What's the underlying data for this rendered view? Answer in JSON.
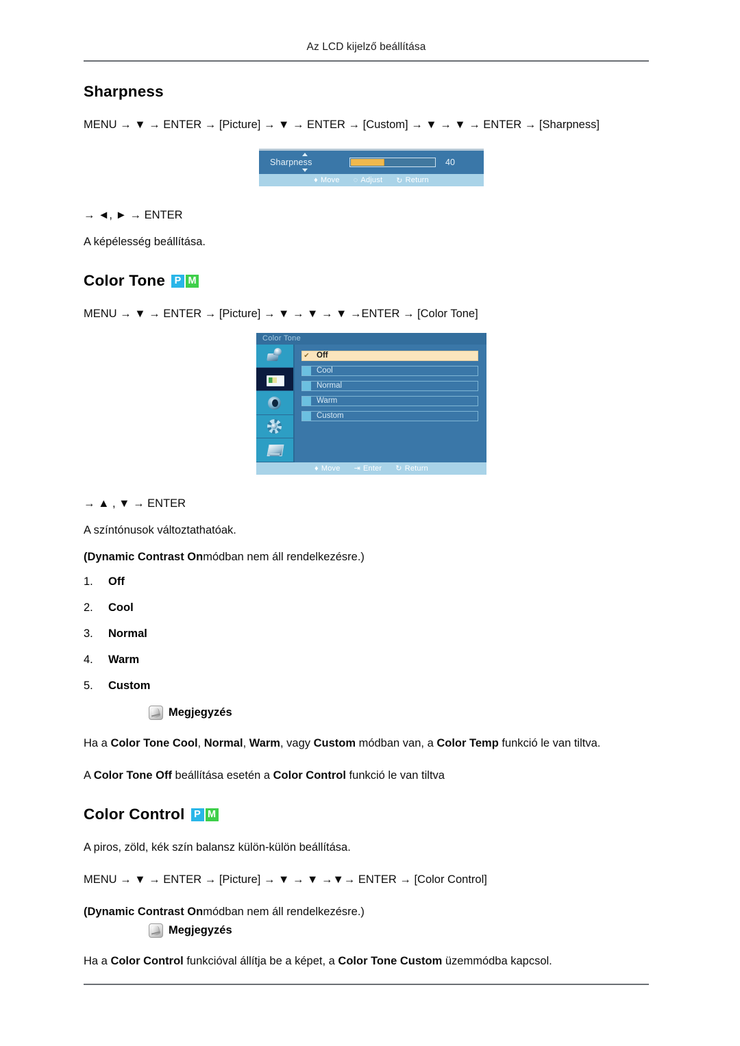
{
  "page": {
    "running_header": "Az LCD kijelző beállítása"
  },
  "sharpness_section": {
    "title": "Sharpness",
    "menu_path": "MENU → ▼ → ENTER → [Picture] → ▼ → ENTER → [Custom] → ▼ → ▼ → ENTER → [Sharpness]",
    "key_path": "→ ◄, ► → ENTER",
    "description": "A képélesség beállítása.",
    "osd": {
      "label": "Sharpness",
      "value": "40",
      "fill_percent": 40,
      "footer": {
        "move": "Move",
        "adjust": "Adjust",
        "return": "Return"
      }
    }
  },
  "color_tone_section": {
    "title": "Color Tone",
    "badges": [
      "P",
      "M"
    ],
    "badge_colors": {
      "p": "#29b6e8",
      "m": "#3ecf4a"
    },
    "menu_path": "MENU → ▼ → ENTER → [Picture] → ▼ → ▼ → ▼ →ENTER → [Color Tone]",
    "key_path": "→ ▲ , ▼ → ENTER",
    "description": "A színtónusok változtathatóak.",
    "availability_note_bold": "(Dynamic Contrast On",
    "availability_note_rest": "módban nem áll rendelkezésre.)",
    "options": [
      {
        "num": "1.",
        "label": "Off"
      },
      {
        "num": "2.",
        "label": "Cool"
      },
      {
        "num": "3.",
        "label": "Normal"
      },
      {
        "num": "4.",
        "label": "Warm"
      },
      {
        "num": "5.",
        "label": "Custom"
      }
    ],
    "note_label": "Megjegyzés",
    "note_lines": [
      {
        "segments": [
          {
            "t": "Ha a ",
            "b": false
          },
          {
            "t": "Color Tone Cool",
            "b": true
          },
          {
            "t": ", ",
            "b": false
          },
          {
            "t": "Normal",
            "b": true
          },
          {
            "t": ", ",
            "b": false
          },
          {
            "t": "Warm",
            "b": true
          },
          {
            "t": ", vagy ",
            "b": false
          },
          {
            "t": "Custom",
            "b": true
          },
          {
            "t": " módban van, a ",
            "b": false
          },
          {
            "t": "Color Temp",
            "b": true
          },
          {
            "t": " funkció le van tiltva.",
            "b": false
          }
        ]
      },
      {
        "segments": [
          {
            "t": "A ",
            "b": false
          },
          {
            "t": "Color Tone Off",
            "b": true
          },
          {
            "t": " beállítása esetén a ",
            "b": false
          },
          {
            "t": "Color Control",
            "b": true
          },
          {
            "t": " funkció le van tiltva",
            "b": false
          }
        ]
      }
    ],
    "osd": {
      "title": "Color Tone",
      "icons": [
        {
          "name": "input-source-icon",
          "active": false
        },
        {
          "name": "picture-icon",
          "active": true
        },
        {
          "name": "sound-icon",
          "active": false
        },
        {
          "name": "setup-gear-icon",
          "active": false
        },
        {
          "name": "multi-control-monitor-icon",
          "active": false
        }
      ],
      "items": [
        {
          "label": "Off",
          "selected": true,
          "check": "✔"
        },
        {
          "label": "Cool",
          "selected": false
        },
        {
          "label": "Normal",
          "selected": false
        },
        {
          "label": "Warm",
          "selected": false
        },
        {
          "label": "Custom",
          "selected": false
        }
      ],
      "footer": {
        "move": "Move",
        "enter": "Enter",
        "return": "Return"
      }
    }
  },
  "color_control_section": {
    "title": "Color Control",
    "badges": [
      "P",
      "M"
    ],
    "description": "A piros, zöld, kék szín balansz külön-külön beállítása.",
    "menu_path": "MENU → ▼ → ENTER → [Picture] → ▼ → ▼ →▼→ ENTER → [Color Control]",
    "availability_note_bold": "(Dynamic Contrast On",
    "availability_note_rest": "módban nem áll rendelkezésre.)",
    "note_label": "Megjegyzés",
    "note_line": {
      "segments": [
        {
          "t": "Ha a ",
          "b": false
        },
        {
          "t": "Color Control",
          "b": true
        },
        {
          "t": " funkcióval állítja be a képet, a ",
          "b": false
        },
        {
          "t": "Color Tone Custom",
          "b": true
        },
        {
          "t": " üzemmódba kapcsol.",
          "b": false
        }
      ]
    }
  }
}
